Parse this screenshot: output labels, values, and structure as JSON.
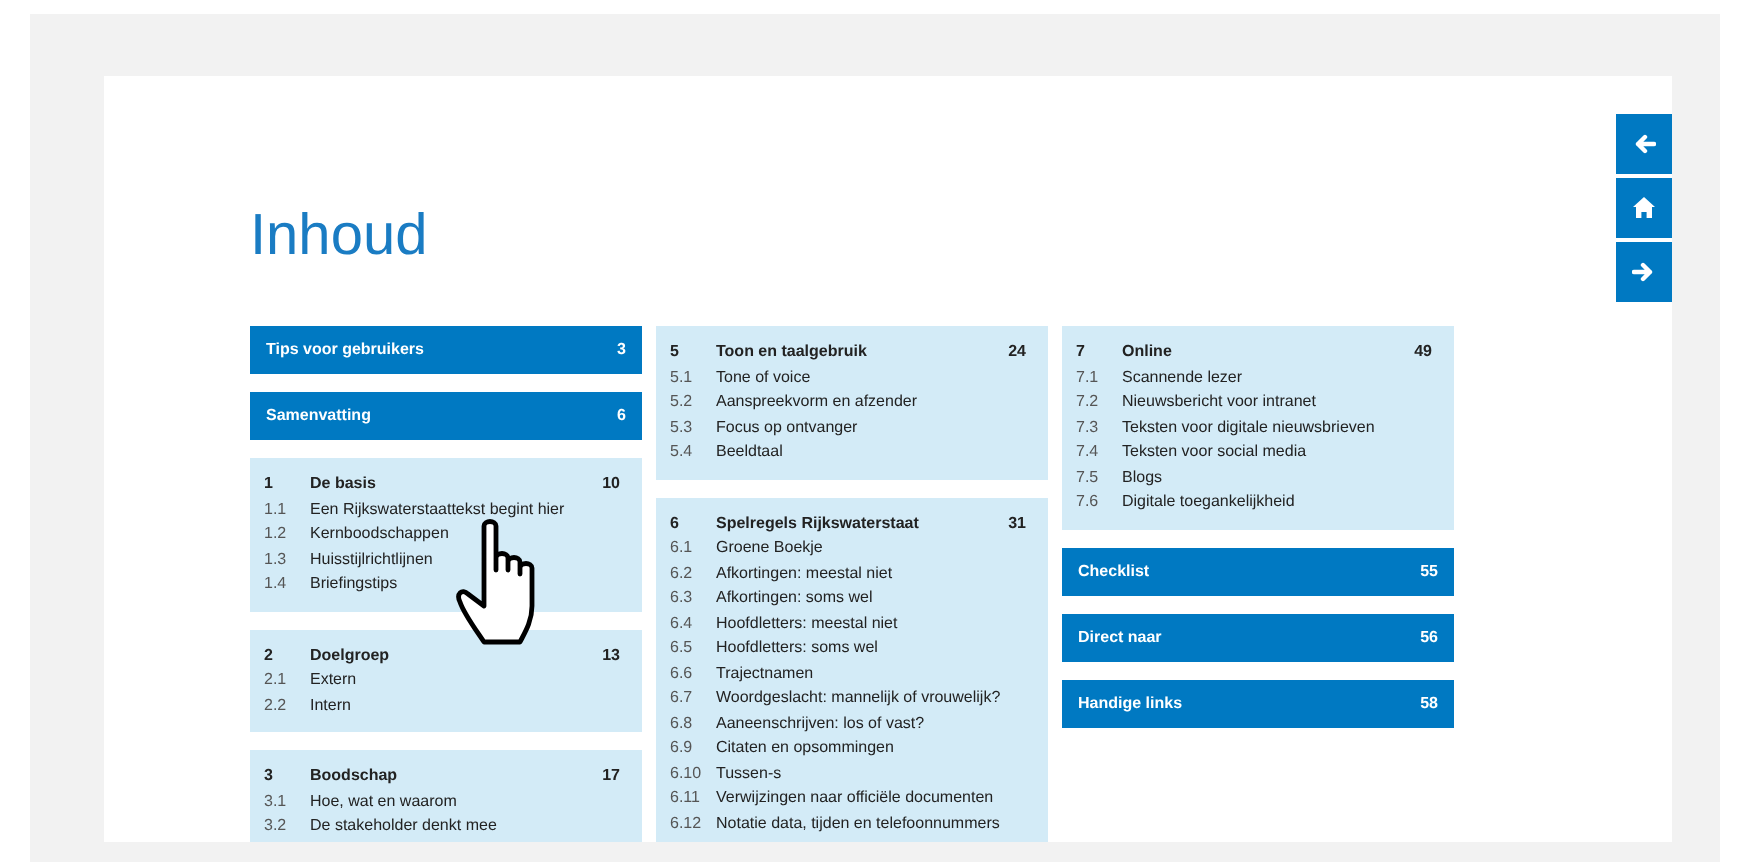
{
  "document": {
    "title": "Inhoud",
    "columns": [
      [
        {
          "kind": "bar",
          "title": "Tips voor gebruikers",
          "page": "3"
        },
        {
          "kind": "bar",
          "title": "Samenvatting",
          "page": "6"
        },
        {
          "kind": "section",
          "number": "1",
          "title": "De basis",
          "page": "10",
          "items": [
            {
              "number": "1.1",
              "title": "Een Rijkswaterstaattekst begint hier"
            },
            {
              "number": "1.2",
              "title": "Kernboodschappen"
            },
            {
              "number": "1.3",
              "title": "Huisstijlrichtlijnen"
            },
            {
              "number": "1.4",
              "title": "Briefingstips"
            }
          ]
        },
        {
          "kind": "section",
          "number": "2",
          "title": "Doelgroep",
          "page": "13",
          "items": [
            {
              "number": "2.1",
              "title": "Extern"
            },
            {
              "number": "2.2",
              "title": "Intern"
            }
          ]
        },
        {
          "kind": "section",
          "number": "3",
          "title": "Boodschap",
          "page": "17",
          "items": [
            {
              "number": "3.1",
              "title": "Hoe, wat en waarom"
            },
            {
              "number": "3.2",
              "title": "De stakeholder denkt mee"
            }
          ]
        }
      ],
      [
        {
          "kind": "section",
          "number": "5",
          "title": "Toon en taalgebruik",
          "page": "24",
          "items": [
            {
              "number": "5.1",
              "title": "Tone of voice"
            },
            {
              "number": "5.2",
              "title": "Aanspreekvorm en afzender"
            },
            {
              "number": "5.3",
              "title": "Focus op ontvanger"
            },
            {
              "number": "5.4",
              "title": "Beeldtaal"
            }
          ]
        },
        {
          "kind": "section",
          "number": "6",
          "title": "Spelregels Rijkswaterstaat",
          "page": "31",
          "items": [
            {
              "number": "6.1",
              "title": "Groene Boekje"
            },
            {
              "number": "6.2",
              "title": "Afkortingen: meestal niet"
            },
            {
              "number": "6.3",
              "title": "Afkortingen: soms wel"
            },
            {
              "number": "6.4",
              "title": "Hoofdletters: meestal niet"
            },
            {
              "number": "6.5",
              "title": "Hoofdletters: soms wel"
            },
            {
              "number": "6.6",
              "title": "Trajectnamen"
            },
            {
              "number": "6.7",
              "title": "Woordgeslacht: mannelijk of vrouwelijk?"
            },
            {
              "number": "6.8",
              "title": "Aaneenschrijven: los of vast?"
            },
            {
              "number": "6.9",
              "title": "Citaten en opsommingen"
            },
            {
              "number": "6.10",
              "title": "Tussen-s"
            },
            {
              "number": "6.11",
              "title": "Verwijzingen naar officiële documenten"
            },
            {
              "number": "6.12",
              "title": "Notatie data, tijden en telefoonnummers"
            }
          ]
        }
      ],
      [
        {
          "kind": "section",
          "number": "7",
          "title": "Online",
          "page": "49",
          "items": [
            {
              "number": "7.1",
              "title": "Scannende lezer"
            },
            {
              "number": "7.2",
              "title": "Nieuwsbericht voor intranet"
            },
            {
              "number": "7.3",
              "title": "Teksten voor digitale nieuwsbrieven"
            },
            {
              "number": "7.4",
              "title": "Teksten voor social media"
            },
            {
              "number": "7.5",
              "title": "Blogs"
            },
            {
              "number": "7.6",
              "title": "Digitale toegankelijkheid"
            }
          ]
        },
        {
          "kind": "bar",
          "title": "Checklist",
          "page": "55"
        },
        {
          "kind": "bar",
          "title": "Direct naar",
          "page": "56"
        },
        {
          "kind": "bar",
          "title": "Handige links",
          "page": "58"
        }
      ]
    ]
  },
  "nav_buttons": [
    {
      "kind": "back"
    },
    {
      "kind": "home"
    },
    {
      "kind": "forward"
    }
  ]
}
